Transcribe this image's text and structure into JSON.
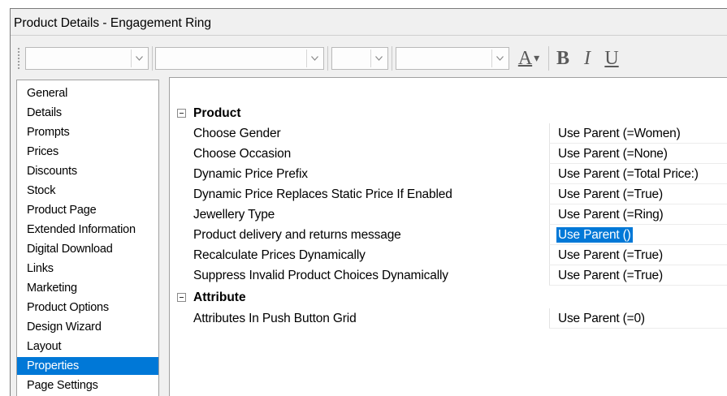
{
  "window": {
    "title": "Product Details - Engagement Ring"
  },
  "toolbar": {
    "combos": [
      {
        "name": "style-combo",
        "value": ""
      },
      {
        "name": "font-combo",
        "value": ""
      },
      {
        "name": "size-combo",
        "value": ""
      },
      {
        "name": "color-combo",
        "value": ""
      }
    ],
    "font_color_glyph": "A",
    "font_color_arrow": "▾",
    "bold_glyph": "B",
    "italic_glyph": "I",
    "underline_glyph": "U"
  },
  "sidebar": {
    "items": [
      {
        "label": "General",
        "selected": false
      },
      {
        "label": "Details",
        "selected": false
      },
      {
        "label": "Prompts",
        "selected": false
      },
      {
        "label": "Prices",
        "selected": false
      },
      {
        "label": "Discounts",
        "selected": false
      },
      {
        "label": "Stock",
        "selected": false
      },
      {
        "label": "Product Page",
        "selected": false
      },
      {
        "label": "Extended Information",
        "selected": false
      },
      {
        "label": "Digital Download",
        "selected": false
      },
      {
        "label": "Links",
        "selected": false
      },
      {
        "label": "Marketing",
        "selected": false
      },
      {
        "label": "Product Options",
        "selected": false
      },
      {
        "label": "Design Wizard",
        "selected": false
      },
      {
        "label": "Layout",
        "selected": false
      },
      {
        "label": "Properties",
        "selected": true
      },
      {
        "label": "Page Settings",
        "selected": false
      }
    ]
  },
  "properties": {
    "categories": [
      {
        "label": "Product",
        "rows": [
          {
            "name": "Choose Gender",
            "value": "Use Parent (=Women)"
          },
          {
            "name": "Choose Occasion",
            "value": "Use Parent (=None)"
          },
          {
            "name": "Dynamic Price Prefix",
            "value": "Use Parent (=Total Price:)"
          },
          {
            "name": "Dynamic Price Replaces Static Price If Enabled",
            "value": "Use Parent (=True)"
          },
          {
            "name": "Jewellery Type",
            "value": "Use Parent (=Ring)"
          },
          {
            "name": "Product delivery and returns message",
            "value": "Use Parent ()",
            "highlighted": true
          },
          {
            "name": "Recalculate Prices Dynamically",
            "value": "Use Parent (=True)"
          },
          {
            "name": "Suppress Invalid Product Choices Dynamically",
            "value": "Use Parent (=True)"
          }
        ]
      },
      {
        "label": "Attribute",
        "rows": [
          {
            "name": "Attributes In Push Button Grid",
            "value": "Use Parent (=0)"
          }
        ]
      }
    ]
  },
  "colors": {
    "selection": "#0078d7",
    "chrome": "#f0f0f0",
    "icon": "#5a5a5a"
  },
  "icons": {
    "collapse": "minus-box-icon",
    "dropdown": "chevron-down-icon",
    "grip": "toolbar-grip-icon"
  }
}
